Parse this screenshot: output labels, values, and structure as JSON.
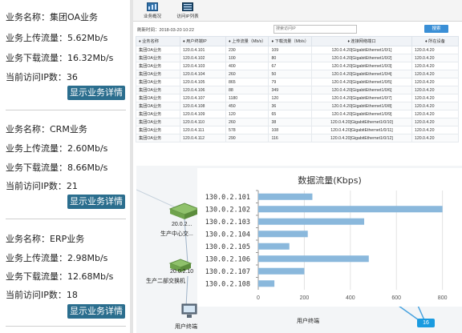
{
  "businesses": [
    {
      "name_line": "业务名称：集团OA业务",
      "up_line": "业务上传流量：5.62Mb/s",
      "down_line": "业务下载流量：16.32Mb/s",
      "ip_line": "当前访问IP数：36",
      "button": "显示业务详情"
    },
    {
      "name_line": "业务名称：CRM业务",
      "up_line": "业务上传流量：2.60Mb/s",
      "down_line": "业务下载流量：8.66Mb/s",
      "ip_line": "当前访问IP数：21",
      "button": "显示业务详情"
    },
    {
      "name_line": "业务名称：ERP业务",
      "up_line": "业务上传流量：2.98Mb/s",
      "down_line": "业务下载流量：12.68Mb/s",
      "ip_line": "当前访问IP数：18",
      "button": "显示业务详情"
    }
  ],
  "toolbar": {
    "overview_label": "业务概况",
    "ip_list_label": "访问IP列表"
  },
  "refresh_text": "刷新时间：2018-03-20 10:22",
  "search": {
    "placeholder": "搜索访问IP",
    "button": "搜索"
  },
  "table": {
    "headers": [
      "业务名称",
      "用户终端IP",
      "上传流量（Mb/s）",
      "下载流量（Mb/s）",
      "连接网络端口",
      "所在设备"
    ],
    "rows": [
      [
        "集团OA业务",
        "120.0.4.101",
        "230",
        "109",
        "120.0.4.20[GigabitEthernet1/0/1]",
        "120.0.4.20"
      ],
      [
        "集团OA业务",
        "120.0.4.102",
        "100",
        "80",
        "120.0.4.20[GigabitEthernet1/0/2]",
        "120.0.4.20"
      ],
      [
        "集团OA业务",
        "120.0.4.103",
        "400",
        "67",
        "120.0.4.20[GigabitEthernet1/0/3]",
        "120.0.4.20"
      ],
      [
        "集团OA业务",
        "120.0.4.104",
        "260",
        "50",
        "120.0.4.20[GigabitEthernet1/0/4]",
        "120.0.4.20"
      ],
      [
        "集团OA业务",
        "120.0.4.105",
        "865",
        "79",
        "120.0.4.20[GigabitEthernet1/0/5]",
        "120.0.4.20"
      ],
      [
        "集团OA业务",
        "120.0.4.106",
        "88",
        "349",
        "120.0.4.20[GigabitEthernet1/0/6]",
        "120.0.4.20"
      ],
      [
        "集团OA业务",
        "120.0.4.107",
        "1180",
        "120",
        "120.0.4.20[GigabitEthernet1/0/7]",
        "120.0.4.20"
      ],
      [
        "集团OA业务",
        "120.0.4.108",
        "450",
        "36",
        "120.0.4.20[GigabitEthernet1/0/8]",
        "120.0.4.20"
      ],
      [
        "集团OA业务",
        "120.0.4.109",
        "120",
        "65",
        "120.0.4.20[GigabitEthernet1/0/9]",
        "120.0.4.20"
      ],
      [
        "集团OA业务",
        "120.0.4.110",
        "260",
        "38",
        "120.0.4.20[GigabitEthernet1/0/10]",
        "120.0.4.20"
      ],
      [
        "集团OA业务",
        "120.0.4.111",
        "578",
        "108",
        "120.0.4.20[GigabitEthernet1/0/11]",
        "120.0.4.20"
      ],
      [
        "集团OA业务",
        "120.0.4.112",
        "290",
        "116",
        "120.0.4.20[GigabitEthernet1/0/12]",
        "120.0.4.20"
      ]
    ]
  },
  "topology": {
    "node1_ip": "20.0.2...",
    "node1_name": "生产中心交...",
    "node2_ip": "20.0.2.10",
    "node2_name": "生产二部交换机",
    "terminal_left": "用户终端",
    "terminal_mid": "用户终端",
    "badge": "16"
  },
  "chart_data": {
    "type": "bar",
    "orientation": "horizontal",
    "title": "数据流量(Kbps)",
    "categories": [
      "130.0.2.101",
      "130.0.2.102",
      "130.0.2.103",
      "130.0.2.104",
      "130.0.2.105",
      "130.0.2.106",
      "130.0.2.107",
      "130.0.2.108"
    ],
    "values": [
      235,
      800,
      460,
      215,
      135,
      480,
      200,
      70
    ],
    "xlim": [
      0,
      850
    ],
    "x_ticks": [
      "0",
      "200",
      "400",
      "600",
      "800"
    ],
    "bar_color": "#8ab8dc",
    "grid": true
  }
}
